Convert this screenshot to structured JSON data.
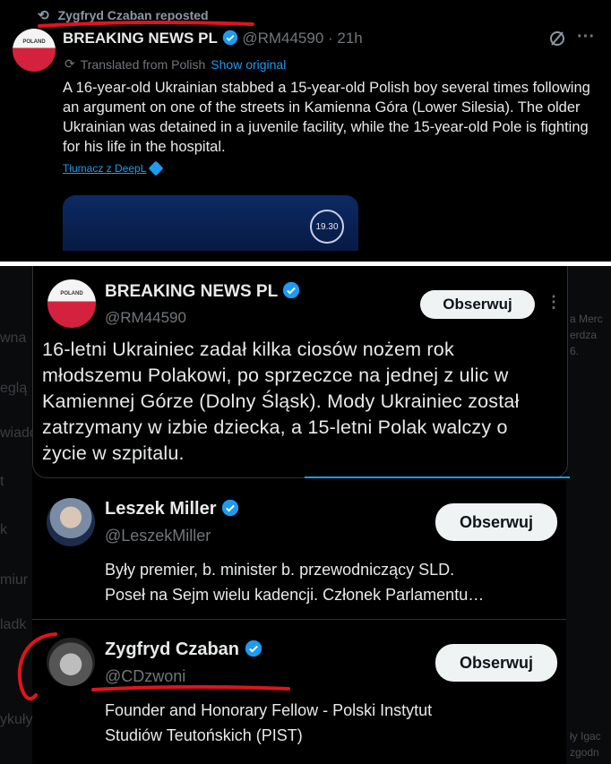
{
  "repost": {
    "text": "Zygfryd Czaban reposted"
  },
  "tweet": {
    "author_name": "BREAKING NEWS PL",
    "handle_time": "@RM44590 · 21h",
    "avatar_text": "POLAND",
    "translated_label": "Translated from Polish",
    "show_original": "Show original",
    "text": "A 16-year-old Ukrainian stabbed a 15-year-old Polish boy several times following an argument on one of the streets in Kamienna Góra (Lower Silesia). The older Ukrainian was detained in a juvenile facility, while the 15-year-old Pole is fighting for his life in the hospital.",
    "deepl_link": "Tłumacz z DeepL",
    "media_badge": "19.30",
    "more": "···"
  },
  "hover_card": {
    "author_name": "BREAKING NEWS PL",
    "handle": "@RM44590",
    "avatar_text": "POLAND",
    "follow_label": "Obserwuj",
    "more": "⋮",
    "text": "16-letni Ukrainiec zadał kilka ciosów nożem rok młodszemu Polakowi, po sprzeczce na jednej z ulic w Kamiennej Górze (Dolny Śląsk). Mody Ukrainiec został zatrzymany w izbie dziecka, a 15-letni Polak walczy o życie w szpitalu."
  },
  "users": [
    {
      "name": "Leszek Miller",
      "handle": "@LeszekMiller",
      "follow_label": "Obserwuj",
      "bio_line1": "Były premier, b. minister b. przewodniczący SLD.",
      "bio_line2": "Poseł na Sejm wielu kadencji. Członek Parlamentu…"
    },
    {
      "name": "Zygfryd Czaban",
      "handle": "@CDzwoni",
      "follow_label": "Obserwuj",
      "bio_line1": "Founder and Honorary Fellow - Polski Instytut",
      "bio_line2": "Studiów Teutońskich (PIST)"
    }
  ],
  "background_left": [
    "wna",
    "eglą",
    "wiado",
    "t",
    "k",
    "miur",
    "ladk",
    "ykuły"
  ],
  "background_right": [
    "a Merc",
    "erdza",
    "6.",
    "ły Igac",
    "zgodn"
  ],
  "colors": {
    "accent": "#1d9bf0",
    "annotation": "#e0141e",
    "follow_bg": "#eff3f4"
  }
}
